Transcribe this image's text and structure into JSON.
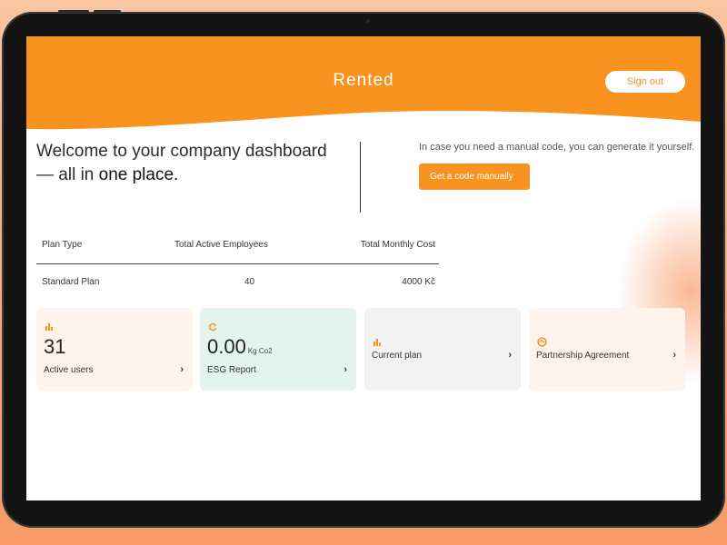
{
  "app": {
    "brand": "Rented",
    "sign_out": "Sign out"
  },
  "welcome": {
    "line1": "Welcome to your company dashboard",
    "line2_prefix": "— all in",
    "line2_emph": "one place."
  },
  "manual_code": {
    "text": "In case you need a manual code, you can generate it yourself.",
    "button": "Get a code manually"
  },
  "plan_table": {
    "headers": [
      "Plan Type",
      "Total Active Employees",
      "Total Monthly Cost"
    ],
    "row": [
      "Standard Plan",
      "40",
      "4000 Kč"
    ]
  },
  "cards": [
    {
      "icon": "bar-chart-icon",
      "value": "31",
      "unit": "",
      "label": "Active users",
      "bg": "#fff4ec"
    },
    {
      "icon": "refresh-icon",
      "value": "0.00",
      "unit": "Kg Co2",
      "label": "ESG Report",
      "bg": "#e3f4ee"
    },
    {
      "icon": "bar-chart-icon",
      "value": "",
      "unit": "",
      "label": "Current plan",
      "bg": "#f2f2f2"
    },
    {
      "icon": "handshake-icon",
      "value": "",
      "unit": "",
      "label": "Partnership Agreement",
      "bg": "#fff4ec"
    }
  ],
  "chevron": "›",
  "colors": {
    "accent": "#f7931e",
    "background": "#f9a877"
  }
}
